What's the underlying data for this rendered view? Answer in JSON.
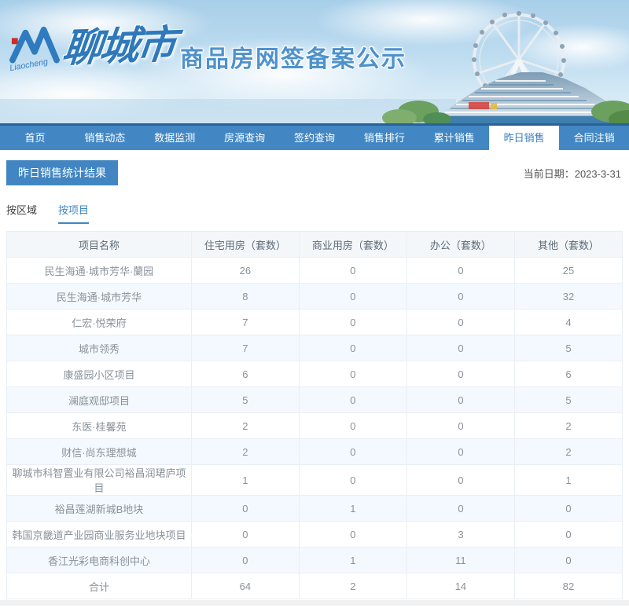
{
  "banner": {
    "logo_script": "Liaocheng",
    "logo_city": "聊城市",
    "title": "商品房网签备案公示"
  },
  "nav": {
    "items": [
      "首页",
      "销售动态",
      "数据监测",
      "房源查询",
      "签约查询",
      "销售排行",
      "累计销售",
      "昨日销售",
      "合同注销"
    ],
    "active": "昨日销售"
  },
  "section": {
    "title": "昨日销售统计结果",
    "date_prefix": "当前日期：",
    "date": "2023-3-31"
  },
  "filter_tabs": {
    "items": [
      "按区域",
      "按项目"
    ],
    "active": "按项目"
  },
  "table": {
    "headers": [
      "项目名称",
      "住宅用房（套数）",
      "商业用房（套数）",
      "办公（套数）",
      "其他（套数）"
    ],
    "rows": [
      [
        "民生海通·城市芳华·蘭园",
        "26",
        "0",
        "0",
        "25"
      ],
      [
        "民生海通·城市芳华",
        "8",
        "0",
        "0",
        "32"
      ],
      [
        "仁宏·悦荣府",
        "7",
        "0",
        "0",
        "4"
      ],
      [
        "城市领秀",
        "7",
        "0",
        "0",
        "5"
      ],
      [
        "康盛园小区项目",
        "6",
        "0",
        "0",
        "6"
      ],
      [
        "澜庭观邸项目",
        "5",
        "0",
        "0",
        "5"
      ],
      [
        "东医·桂馨苑",
        "2",
        "0",
        "0",
        "2"
      ],
      [
        "财信·尚东理想城",
        "2",
        "0",
        "0",
        "2"
      ],
      [
        "聊城市科智置业有限公司裕昌润珺庐项目",
        "1",
        "0",
        "0",
        "1"
      ],
      [
        "裕昌莲湖新城B地块",
        "0",
        "1",
        "0",
        "0"
      ],
      [
        "韩国京畿道产业园商业服务业地块项目",
        "0",
        "0",
        "3",
        "0"
      ],
      [
        "香江光彩电商科创中心",
        "0",
        "1",
        "11",
        "0"
      ],
      [
        "合计",
        "64",
        "2",
        "14",
        "82"
      ]
    ]
  },
  "colors": {
    "nav_blue": "#4287c3",
    "nav_dark_line": "#2a6196",
    "accent_blue": "#4186c2",
    "row_alt": "#f3f9fe",
    "header_bg": "#f3f7fa"
  }
}
